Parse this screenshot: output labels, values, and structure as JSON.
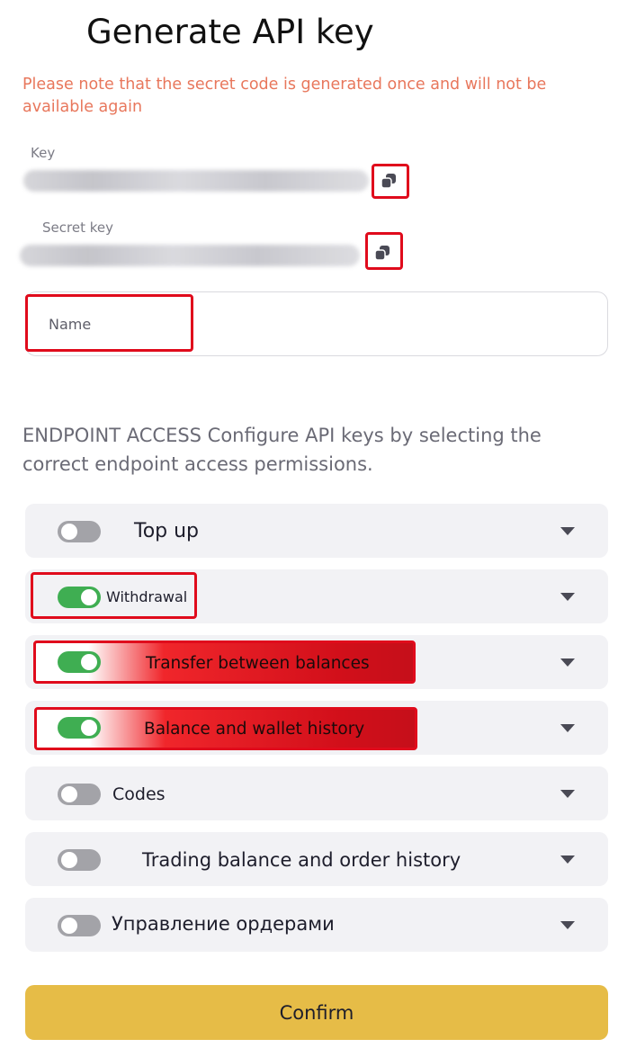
{
  "header": {
    "title": "Generate API key"
  },
  "notice": "Please note that the secret code is generated once and will not be available again",
  "key": {
    "label": "Key"
  },
  "secret_key": {
    "label": "Secret key"
  },
  "name_field": {
    "placeholder": "Name",
    "value": ""
  },
  "endpoint_access": {
    "description": "ENDPOINT ACCESS Configure API keys by selecting the correct endpoint access permissions."
  },
  "permissions": [
    {
      "label": "Top up",
      "enabled": false
    },
    {
      "label": "Withdrawal",
      "enabled": true
    },
    {
      "label": "Transfer between balances",
      "enabled": true
    },
    {
      "label": "Balance and wallet history",
      "enabled": true
    },
    {
      "label": "Codes",
      "enabled": false
    },
    {
      "label": "Trading balance and order history",
      "enabled": false
    },
    {
      "label": "Управление ордерами",
      "enabled": false
    }
  ],
  "confirm_button": {
    "label": "Confirm"
  },
  "icons": {
    "copy": "copy-icon",
    "expand": "chevron-down-icon"
  },
  "colors": {
    "warning": "#e8775c",
    "toggle_on": "#3fae52",
    "toggle_off": "#a3a3a8",
    "highlight": "#e00b1c",
    "confirm_bg": "#e6bc47"
  }
}
